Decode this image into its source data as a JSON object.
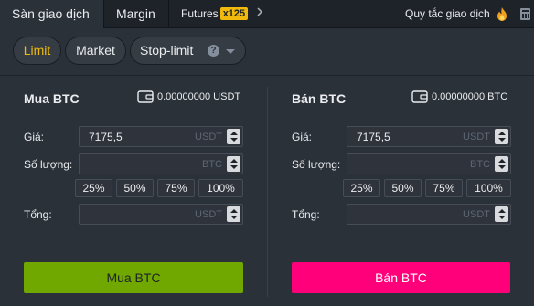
{
  "tabs": {
    "spot": "Sàn giao dịch",
    "margin": "Margin",
    "futures": "Futures",
    "futures_leverage": "x125",
    "rules": "Quy tắc giao dịch"
  },
  "order_types": {
    "limit": "Limit",
    "market": "Market",
    "stop_limit": "Stop-limit",
    "active": "Limit"
  },
  "buy": {
    "title": "Mua BTC",
    "balance": "0.00000000 USDT",
    "price_label": "Giá:",
    "price_value": "7175,5",
    "price_unit": "USDT",
    "amount_label": "Số lượng:",
    "amount_unit": "BTC",
    "total_label": "Tổng:",
    "total_unit": "USDT",
    "percents": [
      "25%",
      "50%",
      "75%",
      "100%"
    ],
    "button": "Mua BTC"
  },
  "sell": {
    "title": "Bán BTC",
    "balance": "0.00000000 BTC",
    "price_label": "Giá:",
    "price_value": "7175,5",
    "price_unit": "USDT",
    "amount_label": "Số lượng:",
    "amount_unit": "BTC",
    "total_label": "Tổng:",
    "total_unit": "USDT",
    "percents": [
      "25%",
      "50%",
      "75%",
      "100%"
    ],
    "button": "Bán BTC"
  },
  "colors": {
    "accent": "#f0b90b",
    "buy": "#70a800",
    "sell": "#ff007a",
    "background": "#2b3139"
  },
  "icons": [
    "chevron-right-icon",
    "fire-icon",
    "calculator-icon",
    "help-icon",
    "chevron-down-icon",
    "wallet-icon",
    "stepper-icon"
  ]
}
